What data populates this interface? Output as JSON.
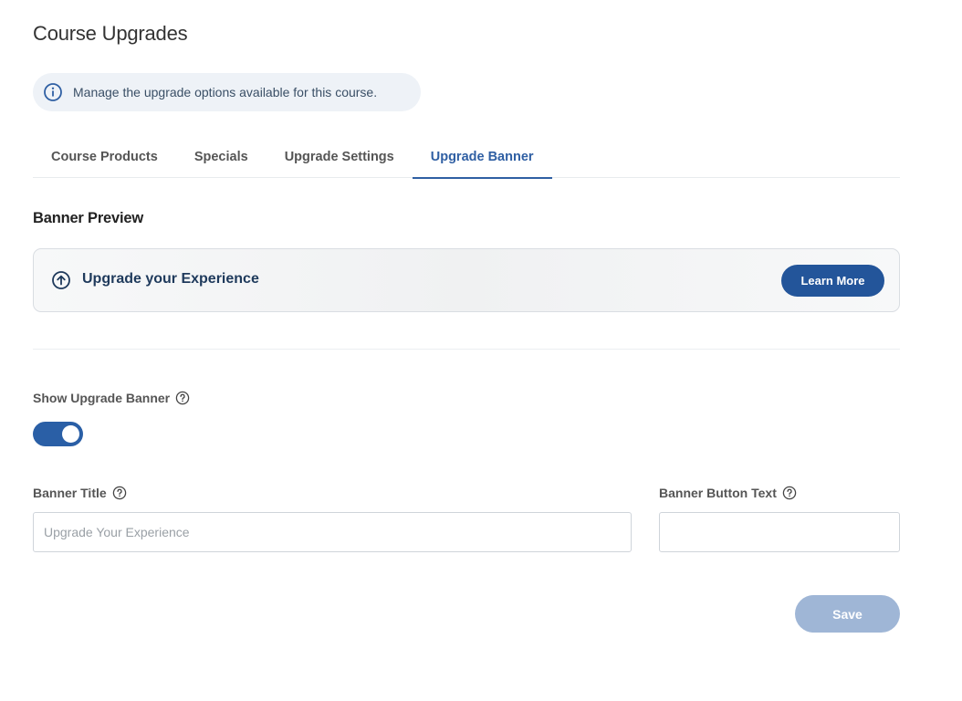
{
  "page": {
    "title": "Course Upgrades"
  },
  "info": {
    "icon": "info-icon",
    "text": "Manage the upgrade options available for this course."
  },
  "tabs": [
    {
      "label": "Course Products",
      "active": false
    },
    {
      "label": "Specials",
      "active": false
    },
    {
      "label": "Upgrade Settings",
      "active": false
    },
    {
      "label": "Upgrade Banner",
      "active": true
    }
  ],
  "preview": {
    "heading": "Banner Preview",
    "banner_icon": "arrow-up-circle-icon",
    "banner_title": "Upgrade your Experience",
    "button_label": "Learn More"
  },
  "form": {
    "show_banner": {
      "label": "Show Upgrade Banner",
      "help_icon": "question-circle-icon",
      "enabled": true
    },
    "banner_title": {
      "label": "Banner Title",
      "help_icon": "question-circle-icon",
      "value": "",
      "placeholder": "Upgrade Your Experience"
    },
    "banner_button_text": {
      "label": "Banner Button Text",
      "help_icon": "question-circle-icon",
      "value": "",
      "placeholder": ""
    },
    "save_label": "Save"
  },
  "colors": {
    "accent": "#2f5fa3",
    "button_primary": "#23559a",
    "toggle_on": "#2a5fa6",
    "save_disabled": "#9fb6d6",
    "callout_bg": "#eef2f7"
  }
}
